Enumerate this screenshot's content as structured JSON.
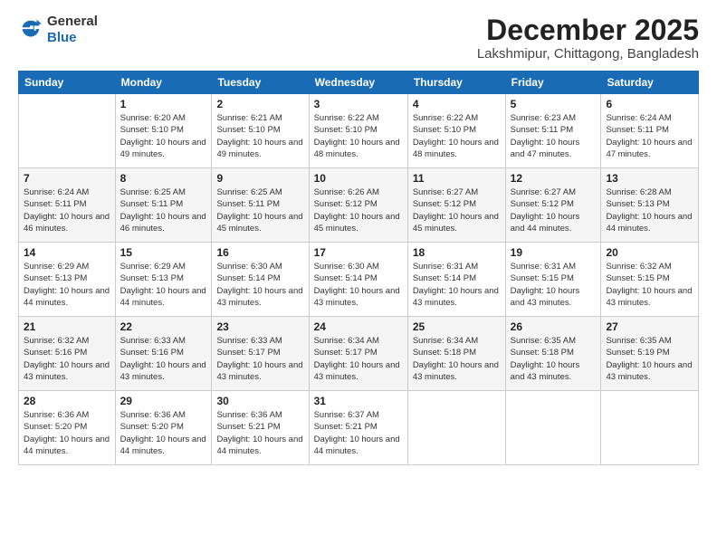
{
  "logo": {
    "general": "General",
    "blue": "Blue"
  },
  "title": "December 2025",
  "location": "Lakshmipur, Chittagong, Bangladesh",
  "headers": [
    "Sunday",
    "Monday",
    "Tuesday",
    "Wednesday",
    "Thursday",
    "Friday",
    "Saturday"
  ],
  "weeks": [
    [
      {
        "day": "",
        "sunrise": "",
        "sunset": "",
        "daylight": ""
      },
      {
        "day": "1",
        "sunrise": "Sunrise: 6:20 AM",
        "sunset": "Sunset: 5:10 PM",
        "daylight": "Daylight: 10 hours and 49 minutes."
      },
      {
        "day": "2",
        "sunrise": "Sunrise: 6:21 AM",
        "sunset": "Sunset: 5:10 PM",
        "daylight": "Daylight: 10 hours and 49 minutes."
      },
      {
        "day": "3",
        "sunrise": "Sunrise: 6:22 AM",
        "sunset": "Sunset: 5:10 PM",
        "daylight": "Daylight: 10 hours and 48 minutes."
      },
      {
        "day": "4",
        "sunrise": "Sunrise: 6:22 AM",
        "sunset": "Sunset: 5:10 PM",
        "daylight": "Daylight: 10 hours and 48 minutes."
      },
      {
        "day": "5",
        "sunrise": "Sunrise: 6:23 AM",
        "sunset": "Sunset: 5:11 PM",
        "daylight": "Daylight: 10 hours and 47 minutes."
      },
      {
        "day": "6",
        "sunrise": "Sunrise: 6:24 AM",
        "sunset": "Sunset: 5:11 PM",
        "daylight": "Daylight: 10 hours and 47 minutes."
      }
    ],
    [
      {
        "day": "7",
        "sunrise": "Sunrise: 6:24 AM",
        "sunset": "Sunset: 5:11 PM",
        "daylight": "Daylight: 10 hours and 46 minutes."
      },
      {
        "day": "8",
        "sunrise": "Sunrise: 6:25 AM",
        "sunset": "Sunset: 5:11 PM",
        "daylight": "Daylight: 10 hours and 46 minutes."
      },
      {
        "day": "9",
        "sunrise": "Sunrise: 6:25 AM",
        "sunset": "Sunset: 5:11 PM",
        "daylight": "Daylight: 10 hours and 45 minutes."
      },
      {
        "day": "10",
        "sunrise": "Sunrise: 6:26 AM",
        "sunset": "Sunset: 5:12 PM",
        "daylight": "Daylight: 10 hours and 45 minutes."
      },
      {
        "day": "11",
        "sunrise": "Sunrise: 6:27 AM",
        "sunset": "Sunset: 5:12 PM",
        "daylight": "Daylight: 10 hours and 45 minutes."
      },
      {
        "day": "12",
        "sunrise": "Sunrise: 6:27 AM",
        "sunset": "Sunset: 5:12 PM",
        "daylight": "Daylight: 10 hours and 44 minutes."
      },
      {
        "day": "13",
        "sunrise": "Sunrise: 6:28 AM",
        "sunset": "Sunset: 5:13 PM",
        "daylight": "Daylight: 10 hours and 44 minutes."
      }
    ],
    [
      {
        "day": "14",
        "sunrise": "Sunrise: 6:29 AM",
        "sunset": "Sunset: 5:13 PM",
        "daylight": "Daylight: 10 hours and 44 minutes."
      },
      {
        "day": "15",
        "sunrise": "Sunrise: 6:29 AM",
        "sunset": "Sunset: 5:13 PM",
        "daylight": "Daylight: 10 hours and 44 minutes."
      },
      {
        "day": "16",
        "sunrise": "Sunrise: 6:30 AM",
        "sunset": "Sunset: 5:14 PM",
        "daylight": "Daylight: 10 hours and 43 minutes."
      },
      {
        "day": "17",
        "sunrise": "Sunrise: 6:30 AM",
        "sunset": "Sunset: 5:14 PM",
        "daylight": "Daylight: 10 hours and 43 minutes."
      },
      {
        "day": "18",
        "sunrise": "Sunrise: 6:31 AM",
        "sunset": "Sunset: 5:14 PM",
        "daylight": "Daylight: 10 hours and 43 minutes."
      },
      {
        "day": "19",
        "sunrise": "Sunrise: 6:31 AM",
        "sunset": "Sunset: 5:15 PM",
        "daylight": "Daylight: 10 hours and 43 minutes."
      },
      {
        "day": "20",
        "sunrise": "Sunrise: 6:32 AM",
        "sunset": "Sunset: 5:15 PM",
        "daylight": "Daylight: 10 hours and 43 minutes."
      }
    ],
    [
      {
        "day": "21",
        "sunrise": "Sunrise: 6:32 AM",
        "sunset": "Sunset: 5:16 PM",
        "daylight": "Daylight: 10 hours and 43 minutes."
      },
      {
        "day": "22",
        "sunrise": "Sunrise: 6:33 AM",
        "sunset": "Sunset: 5:16 PM",
        "daylight": "Daylight: 10 hours and 43 minutes."
      },
      {
        "day": "23",
        "sunrise": "Sunrise: 6:33 AM",
        "sunset": "Sunset: 5:17 PM",
        "daylight": "Daylight: 10 hours and 43 minutes."
      },
      {
        "day": "24",
        "sunrise": "Sunrise: 6:34 AM",
        "sunset": "Sunset: 5:17 PM",
        "daylight": "Daylight: 10 hours and 43 minutes."
      },
      {
        "day": "25",
        "sunrise": "Sunrise: 6:34 AM",
        "sunset": "Sunset: 5:18 PM",
        "daylight": "Daylight: 10 hours and 43 minutes."
      },
      {
        "day": "26",
        "sunrise": "Sunrise: 6:35 AM",
        "sunset": "Sunset: 5:18 PM",
        "daylight": "Daylight: 10 hours and 43 minutes."
      },
      {
        "day": "27",
        "sunrise": "Sunrise: 6:35 AM",
        "sunset": "Sunset: 5:19 PM",
        "daylight": "Daylight: 10 hours and 43 minutes."
      }
    ],
    [
      {
        "day": "28",
        "sunrise": "Sunrise: 6:36 AM",
        "sunset": "Sunset: 5:20 PM",
        "daylight": "Daylight: 10 hours and 44 minutes."
      },
      {
        "day": "29",
        "sunrise": "Sunrise: 6:36 AM",
        "sunset": "Sunset: 5:20 PM",
        "daylight": "Daylight: 10 hours and 44 minutes."
      },
      {
        "day": "30",
        "sunrise": "Sunrise: 6:36 AM",
        "sunset": "Sunset: 5:21 PM",
        "daylight": "Daylight: 10 hours and 44 minutes."
      },
      {
        "day": "31",
        "sunrise": "Sunrise: 6:37 AM",
        "sunset": "Sunset: 5:21 PM",
        "daylight": "Daylight: 10 hours and 44 minutes."
      },
      {
        "day": "",
        "sunrise": "",
        "sunset": "",
        "daylight": ""
      },
      {
        "day": "",
        "sunrise": "",
        "sunset": "",
        "daylight": ""
      },
      {
        "day": "",
        "sunrise": "",
        "sunset": "",
        "daylight": ""
      }
    ]
  ]
}
